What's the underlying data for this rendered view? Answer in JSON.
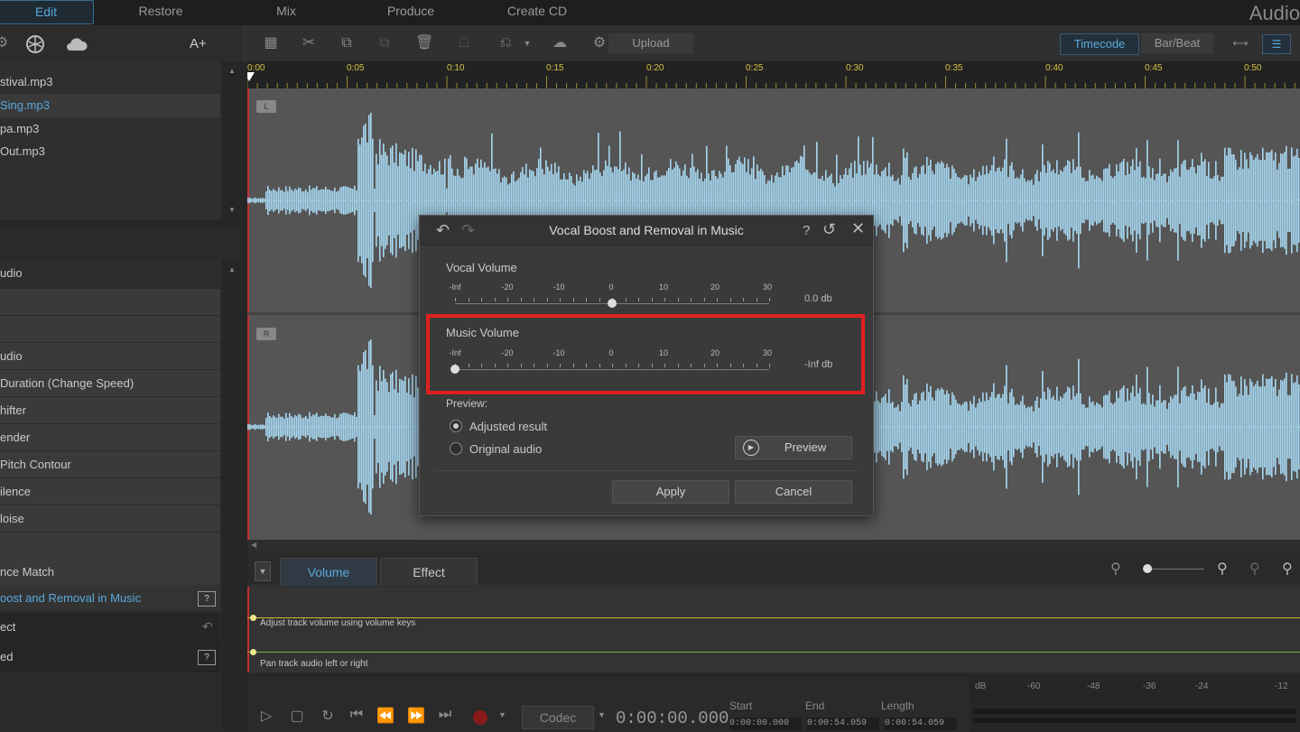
{
  "app_title": "Audio",
  "menu": {
    "tabs": [
      "Edit",
      "Restore",
      "Mix",
      "Produce",
      "Create CD"
    ],
    "active": "Edit"
  },
  "left_toolbar": {
    "text_size_label": "A+"
  },
  "files": [
    {
      "name": "stival.mp3",
      "selected": false
    },
    {
      "name": "Sing.mp3",
      "selected": true
    },
    {
      "name": "pa.mp3",
      "selected": false
    },
    {
      "name": "Out.mp3",
      "selected": false
    }
  ],
  "effects": {
    "group_label": "udio",
    "items": [
      {
        "label": "",
        "selected": false
      },
      {
        "label": "",
        "selected": false
      },
      {
        "label": "udio",
        "selected": false
      },
      {
        "label": "Duration (Change Speed)",
        "selected": false
      },
      {
        "label": "hifter",
        "selected": false
      },
      {
        "label": "ender",
        "selected": false
      },
      {
        "label": "Pitch Contour",
        "selected": false
      },
      {
        "label": "ilence",
        "selected": false
      },
      {
        "label": "loise",
        "selected": false
      },
      {
        "label": "",
        "selected": false
      },
      {
        "label": "nce Match",
        "selected": false
      },
      {
        "label": "oost and Removal in Music",
        "selected": true
      }
    ],
    "footer_groups": [
      "ect",
      "ed"
    ]
  },
  "toolbar": {
    "upload_label": "Upload",
    "timecode_label": "Timecode",
    "barbeat_label": "Bar/Beat",
    "active_mode": "Timecode"
  },
  "ruler": {
    "ticks": [
      "0:00",
      "0:05",
      "0:10",
      "0:15",
      "0:20",
      "0:25",
      "0:30",
      "0:35",
      "0:40",
      "0:45",
      "0:50"
    ]
  },
  "channels": {
    "left": "L",
    "right": "R"
  },
  "dialog": {
    "title": "Vocal Boost and Removal in Music",
    "help": "?",
    "scale": [
      "-Inf",
      "-20",
      "-10",
      "0",
      "10",
      "20",
      "30"
    ],
    "vocal": {
      "label": "Vocal Volume",
      "value_text": "0.0 db",
      "position": 0.5
    },
    "music": {
      "label": "Music Volume",
      "value_text": "-Inf db",
      "position": 0.0
    },
    "preview_label": "Preview:",
    "option_adjusted": "Adjusted result",
    "option_original": "Original audio",
    "selected_option": "adjusted",
    "preview_button": "Preview",
    "apply_button": "Apply",
    "cancel_button": "Cancel"
  },
  "bottom": {
    "tabs": [
      "Volume",
      "Effect"
    ],
    "active_tab": "Volume",
    "volume_hint": "Adjust track volume using volume keys",
    "pan_hint": "Pan track audio left or right"
  },
  "transport": {
    "codec_label": "Codec",
    "time": "0:00:00.000",
    "start_label": "Start",
    "end_label": "End",
    "length_label": "Length",
    "start_value": "0:00:00.000",
    "end_value": "0:00:54.059",
    "length_value": "0:00:54.059"
  },
  "meter": {
    "labels": [
      "dB",
      "-60",
      "-48",
      "-36",
      "-24",
      "-12"
    ]
  },
  "colors": {
    "accent": "#5aa8dd",
    "waveform": "#a6d7f0",
    "highlight": "#e02020",
    "ruler": "#d8c244"
  }
}
